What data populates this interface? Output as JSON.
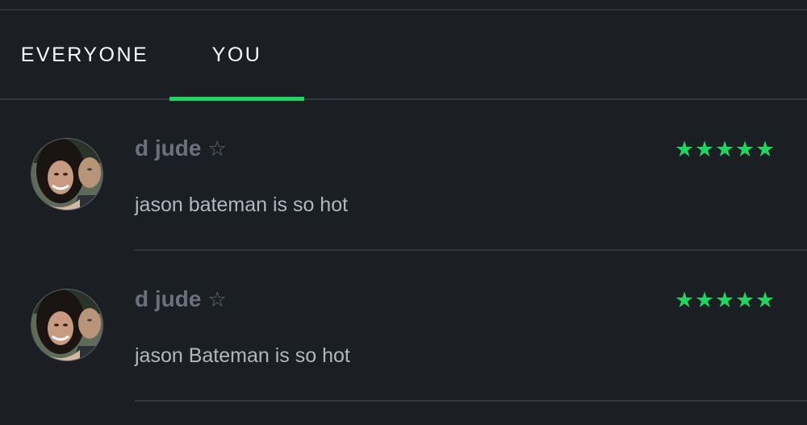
{
  "tabs": {
    "everyone": "EVERYONE",
    "you": "YOU",
    "active": "you"
  },
  "accent_color": "#1ed760",
  "reviews": [
    {
      "author": "d jude",
      "author_badge_icon": "outline-star-icon",
      "author_badge_glyph": "☆",
      "rating": 5,
      "rating_max": 5,
      "rating_stars": [
        "★",
        "★",
        "★",
        "★",
        "★"
      ],
      "text": "jason bateman is so hot",
      "avatar_icon": "user-avatar-photo"
    },
    {
      "author": "d jude",
      "author_badge_icon": "outline-star-icon",
      "author_badge_glyph": "☆",
      "rating": 5,
      "rating_max": 5,
      "rating_stars": [
        "★",
        "★",
        "★",
        "★",
        "★"
      ],
      "text": "jason Bateman is so hot",
      "avatar_icon": "user-avatar-photo"
    }
  ]
}
